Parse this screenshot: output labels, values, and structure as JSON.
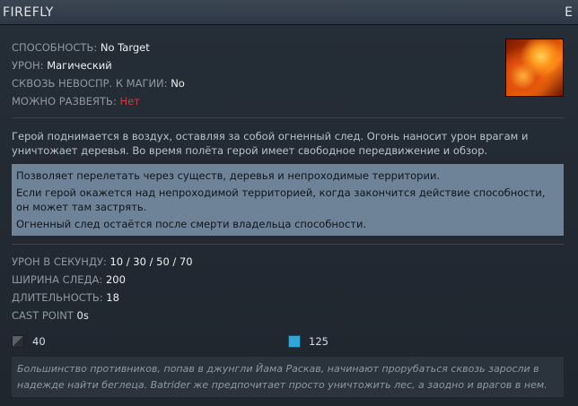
{
  "header": {
    "title": "FIREFLY",
    "hotkey": "E"
  },
  "ability": {
    "behavior_label": "СПОСОБНОСТЬ:",
    "behavior_value": "No Target",
    "damage_label": "УРОН:",
    "damage_value": "Магический",
    "pierce_label": "СКВОЗЬ НЕВОСПР. К МАГИИ:",
    "pierce_value": "No",
    "dispel_label": "МОЖНО РАЗВЕЯТЬ:",
    "dispel_value": "Нет"
  },
  "description": "Герой поднимается в воздух, оставляя за собой огненный след. Огонь наносит урон врагам и уничтожает деревья. Во время полёта герой имеет свободное передвижение и обзор.",
  "notes": [
    "Позволяет перелетать через существ, деревья и непроходимые территории.",
    "Если герой окажется над непроходимой территорией, когда закончится действие способности, он может там застрять.",
    "Огненный след остаётся после смерти владельца способности."
  ],
  "stats": {
    "dps_label": "УРОН В СЕКУНДУ:",
    "dps_value": "10 / 30 / 50 / 70",
    "width_label": "ШИРИНА СЛЕДА:",
    "width_value": "200",
    "duration_label": "ДЛИТЕЛЬНОСТЬ:",
    "duration_value": "18",
    "castpoint_label": "CAST POINT",
    "castpoint_value": "0s"
  },
  "cost": {
    "cooldown": "40",
    "mana": "125"
  },
  "lore": "Большинство противников, попав в джунгли Йама Раскав, начинают прорубаться сквозь заросли в надежде найти беглеца. Batrider же предпочитает просто уничтожить лес, а заодно и врагов в нем.",
  "colors": {
    "mana": "#2fa7d8",
    "dispel_no": "#d33b3b",
    "notes_bg": "#6e8398"
  },
  "icons": {
    "ability": "firefly-ability-icon",
    "cooldown": "cooldown-icon",
    "mana": "mana-icon"
  }
}
